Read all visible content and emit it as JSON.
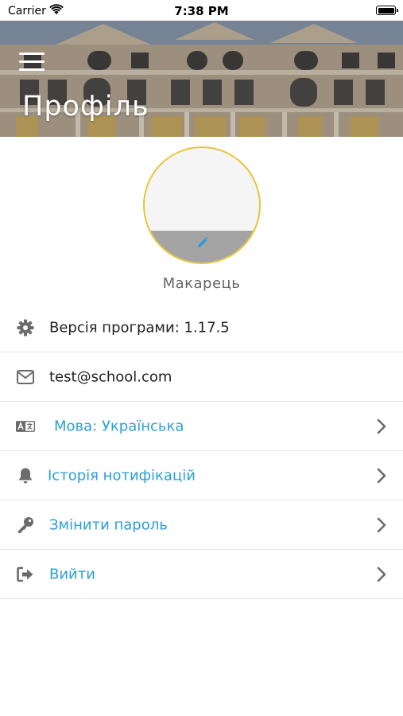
{
  "status_bar": {
    "carrier": "Carrier",
    "time": "7:38 PM"
  },
  "header": {
    "title": "Профіль",
    "menu_icon": "hamburger-menu-icon"
  },
  "profile": {
    "username": "Макарець",
    "edit_icon": "pencil-icon"
  },
  "list": [
    {
      "icon": "gear-icon",
      "label": "Версія програми: 1.17.5",
      "clickable": false
    },
    {
      "icon": "envelope-icon",
      "label": "test@school.com",
      "clickable": false
    },
    {
      "icon": "language-icon",
      "label": "Мова: Українська",
      "clickable": true
    },
    {
      "icon": "bell-icon",
      "label": "Історія нотифікацій",
      "clickable": true
    },
    {
      "icon": "key-icon",
      "label": "Змінити пароль",
      "clickable": true
    },
    {
      "icon": "sign-out-icon",
      "label": "Вийти",
      "clickable": true
    }
  ],
  "colors": {
    "accent_link": "#2a9fd6",
    "avatar_border": "#e8c53a",
    "icon_gray": "#6b6b6b"
  }
}
